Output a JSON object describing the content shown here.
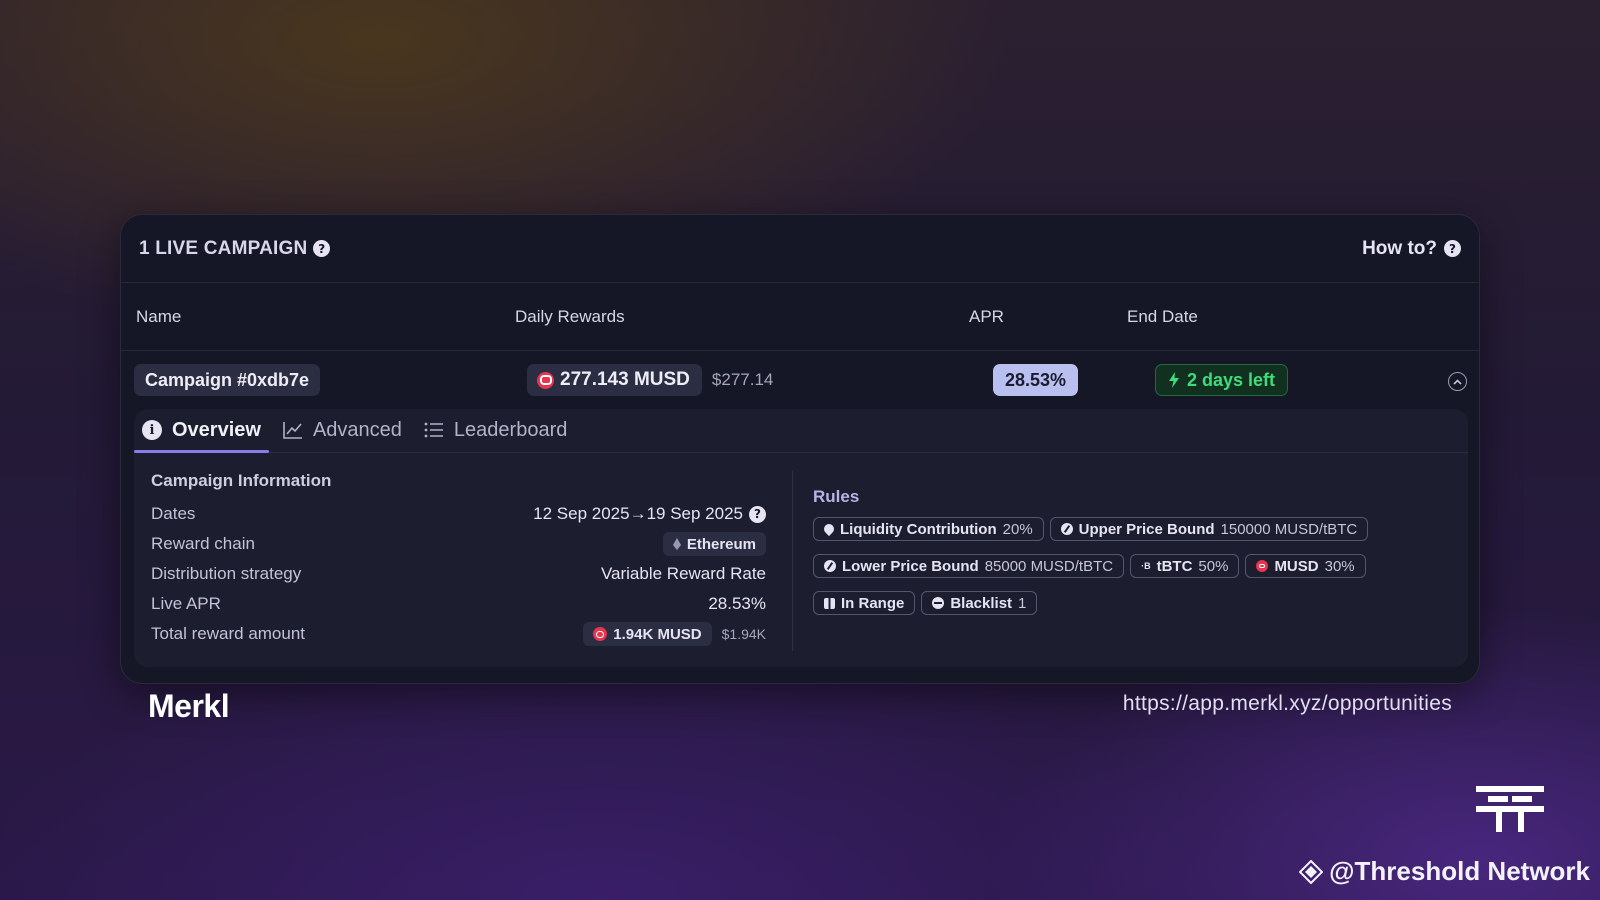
{
  "header": {
    "title": "1 LIVE CAMPAIGN",
    "help_glyph": "?",
    "howto_label": "How to?"
  },
  "columns": {
    "name": "Name",
    "daily_rewards": "Daily Rewards",
    "apr": "APR",
    "end_date": "End Date"
  },
  "campaign": {
    "name": "Campaign #0xdb7e",
    "daily_amount": "277.143 MUSD",
    "daily_usd": "$277.14",
    "apr": "28.53%",
    "end": "2 days left"
  },
  "tabs": [
    {
      "label": "Overview",
      "active": true
    },
    {
      "label": "Advanced",
      "active": false
    },
    {
      "label": "Leaderboard",
      "active": false
    }
  ],
  "info": {
    "title": "Campaign Information",
    "dates_label": "Dates",
    "dates_value": "12 Sep 2025→19 Sep 2025",
    "chain_label": "Reward chain",
    "chain_value": "Ethereum",
    "strategy_label": "Distribution strategy",
    "strategy_value": "Variable Reward Rate",
    "apr_label": "Live APR",
    "apr_value": "28.53%",
    "total_label": "Total reward amount",
    "total_value": "1.94K MUSD",
    "total_usd": "$1.94K"
  },
  "rules": {
    "title": "Rules",
    "items": [
      {
        "name": "Liquidity Contribution",
        "value": "20%"
      },
      {
        "name": "Upper Price Bound",
        "value": "150000 MUSD/tBTC"
      },
      {
        "name": "Lower Price Bound",
        "value": "85000 MUSD/tBTC"
      },
      {
        "name": "tBTC",
        "value": "50%"
      },
      {
        "name": "MUSD",
        "value": "30%"
      },
      {
        "name": "In Range",
        "value": ""
      },
      {
        "name": "Blacklist",
        "value": "1"
      }
    ]
  },
  "footer": {
    "logo": "Merkl",
    "url": "https://app.merkl.xyz/opportunities",
    "watermark": "@Threshold Network"
  },
  "colors": {
    "accent": "#8a7be6",
    "apr_chip": "#b9c0f0",
    "success": "#3fdc7b",
    "musd_red": "#e8344e",
    "card_bg": "#161726"
  },
  "icons": {
    "help": "question-circle-icon",
    "tab_overview": "info-circle-icon",
    "tab_advanced": "line-chart-icon",
    "tab_leaderboard": "list-icon",
    "end_date": "lightning-bolt-icon",
    "collapse": "chevron-up-circle-icon"
  }
}
